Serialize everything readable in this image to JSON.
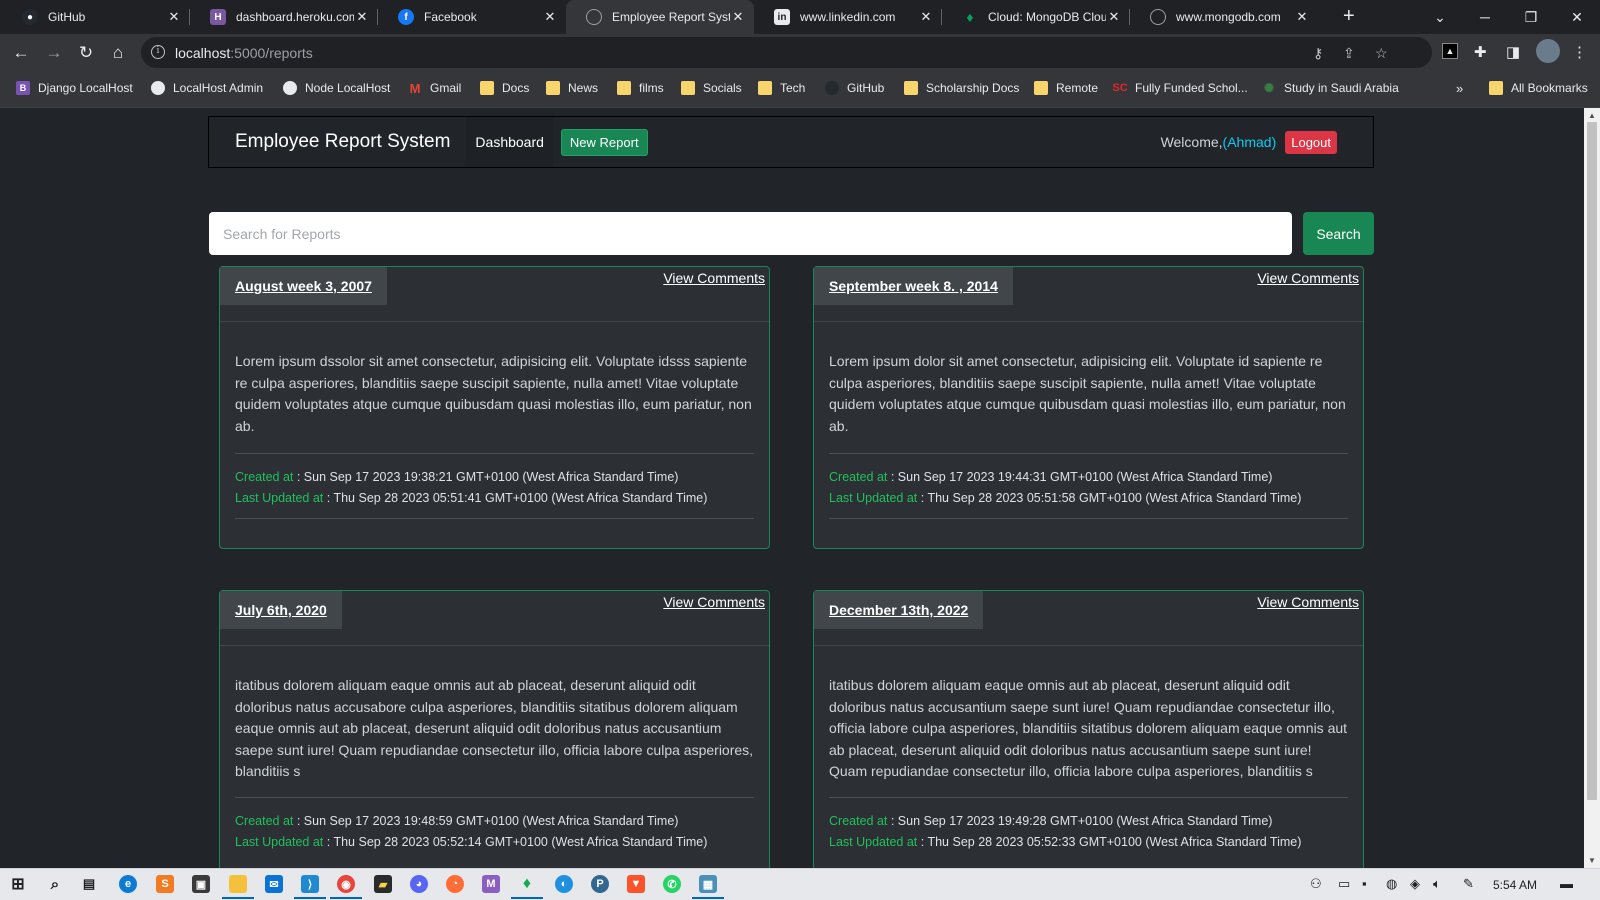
{
  "browser": {
    "tabs": [
      {
        "title": "GitHub",
        "icon": "github-icon",
        "color": "#24292f"
      },
      {
        "title": "dashboard.heroku.com",
        "icon": "heroku-icon",
        "color": "#79589f"
      },
      {
        "title": "Facebook",
        "icon": "facebook-icon",
        "color": "#1877f2"
      },
      {
        "title": "Employee Report Syste",
        "icon": "globe-icon",
        "color": "#5f6368",
        "active": true
      },
      {
        "title": "www.linkedin.com",
        "icon": "linkedin-icon",
        "color": "#0a66c2"
      },
      {
        "title": "Cloud: MongoDB Clou",
        "icon": "mongodb-leaf-icon",
        "color": "#00a35c"
      },
      {
        "title": "www.mongodb.com",
        "icon": "globe-icon",
        "color": "#5f6368"
      }
    ],
    "url_host": "localhost",
    "url_path": ":5000/reports",
    "bookmarks": [
      {
        "label": "Django LocalHost",
        "icon": "bootstrap-icon",
        "color": "#7952b3"
      },
      {
        "label": "LocalHost Admin",
        "icon": "globe-icon",
        "color": "#5f6368"
      },
      {
        "label": "Node LocalHost",
        "icon": "globe-icon",
        "color": "#5f6368"
      },
      {
        "label": "Gmail",
        "icon": "gmail-icon",
        "color": "#ea4335"
      },
      {
        "label": "Docs",
        "icon": "folder-icon"
      },
      {
        "label": "News",
        "icon": "folder-icon"
      },
      {
        "label": "films",
        "icon": "folder-icon"
      },
      {
        "label": "Socials",
        "icon": "folder-icon"
      },
      {
        "label": "Tech",
        "icon": "folder-icon"
      },
      {
        "label": "GitHub",
        "icon": "github-icon",
        "color": "#24292f"
      },
      {
        "label": "Scholarship Docs",
        "icon": "folder-icon"
      },
      {
        "label": "Remote",
        "icon": "folder-icon"
      },
      {
        "label": "Fully Funded Schol...",
        "icon": "sc-icon",
        "color": "#e3262c"
      },
      {
        "label": "Study in Saudi Arabia",
        "icon": "ornament-icon",
        "color": "#3a7d44"
      }
    ],
    "more_bookmarks": "»",
    "all_bookmarks": "All Bookmarks"
  },
  "app": {
    "brand": "Employee Report System",
    "nav_dashboard": "Dashboard",
    "new_report": "New Report",
    "welcome_prefix": "Welcome,",
    "username": "(Ahmad)",
    "logout": "Logout",
    "search_placeholder": "Search for Reports",
    "search_button": "Search",
    "created_label": "Created at",
    "updated_label": "Last Updated at",
    "view_comments": "View Comments",
    "reports": [
      {
        "title": "August week 3, 2007",
        "text": "Lorem ipsum dssolor sit amet consectetur, adipisicing elit. Voluptate idsss sapiente re culpa asperiores, blanditiis saepe suscipit sapiente, nulla amet! Vitae voluptate quidem voluptates atque cumque quibusdam quasi molestias illo, eum pariatur, non ab.",
        "created": "Sun Sep 17 2023 19:38:21 GMT+0100 (West Africa Standard Time)",
        "updated": "Thu Sep 28 2023 05:51:41 GMT+0100 (West Africa Standard Time)"
      },
      {
        "title": "September week 8. , 2014",
        "text": "Lorem ipsum dolor sit amet consectetur, adipisicing elit. Voluptate id sapiente re culpa asperiores, blanditiis saepe suscipit sapiente, nulla amet! Vitae voluptate quidem voluptates atque cumque quibusdam quasi molestias illo, eum pariatur, non ab.",
        "created": "Sun Sep 17 2023 19:44:31 GMT+0100 (West Africa Standard Time)",
        "updated": "Thu Sep 28 2023 05:51:58 GMT+0100 (West Africa Standard Time)"
      },
      {
        "title": "July 6th, 2020",
        "text": "itatibus dolorem aliquam eaque omnis aut ab placeat, deserunt aliquid odit doloribus natus accusabore culpa asperiores, blanditiis sitatibus dolorem aliquam eaque omnis aut ab placeat, deserunt aliquid odit doloribus natus accusantium saepe sunt iure! Quam repudiandae consectetur illo, officia labore culpa asperiores, blanditiis s",
        "created": "Sun Sep 17 2023 19:48:59 GMT+0100 (West Africa Standard Time)",
        "updated": "Thu Sep 28 2023 05:52:14 GMT+0100 (West Africa Standard Time)"
      },
      {
        "title": "December 13th, 2022",
        "text": "itatibus dolorem aliquam eaque omnis aut ab placeat, deserunt aliquid odit doloribus natus accusantium saepe sunt iure! Quam repudiandae consectetur illo, officia labore culpa asperiores, blanditiis sitatibus dolorem aliquam eaque omnis aut ab placeat, deserunt aliquid odit doloribus natus accusantium saepe sunt iure! Quam repudiandae consectetur illo, officia labore culpa asperiores, blanditiis s",
        "created": "Sun Sep 17 2023 19:49:28 GMT+0100 (West Africa Standard Time)",
        "updated": "Thu Sep 28 2023 05:52:33 GMT+0100 (West Africa Standard Time)"
      }
    ]
  },
  "taskbar": {
    "apps": [
      {
        "icon": "windows-start-icon",
        "color": "#0078d4"
      },
      {
        "icon": "search-icon",
        "color": "#202124"
      },
      {
        "icon": "task-view-icon",
        "color": "#202124"
      },
      {
        "icon": "edge-icon",
        "color": "#0c7bd6"
      },
      {
        "icon": "sublime-icon",
        "color": "#f17b22"
      },
      {
        "icon": "store-icon",
        "color": "#3a3a3a"
      },
      {
        "icon": "file-explorer-icon",
        "color": "#f4c13d"
      },
      {
        "icon": "mail-icon",
        "color": "#0a74d4"
      },
      {
        "icon": "vscode-icon",
        "color": "#1f8ad2"
      },
      {
        "icon": "chrome-icon",
        "color": "#e8453c"
      },
      {
        "icon": "sticky-icon",
        "color": "#2b2b2b"
      },
      {
        "icon": "discord-icon",
        "color": "#5865f2"
      },
      {
        "icon": "postman-icon",
        "color": "#ff6c37"
      },
      {
        "icon": "visual-studio-icon",
        "color": "#8b5fbf"
      },
      {
        "icon": "mongodb-compass-icon",
        "color": "#13aa52"
      },
      {
        "icon": "edge-dev-icon",
        "color": "#1f8fe0"
      },
      {
        "icon": "postgres-icon",
        "color": "#336791"
      },
      {
        "icon": "brave-icon",
        "color": "#fb542b"
      },
      {
        "icon": "whatsapp-icon",
        "color": "#25d366"
      },
      {
        "icon": "rdp-icon",
        "color": "#4a90b8"
      }
    ],
    "time": "5:54 AM"
  }
}
